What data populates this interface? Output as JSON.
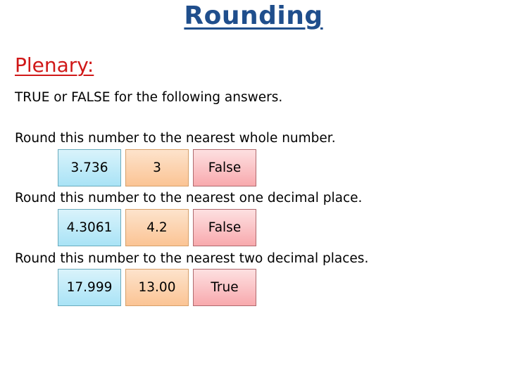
{
  "header": {
    "title": "Rounding"
  },
  "section_label": "Plenary:",
  "instruction": "TRUE or FALSE for the following answers.",
  "questions": [
    {
      "prompt": "Round this number to the nearest whole number.",
      "number": "3.736",
      "answer": "3",
      "verdict": "False"
    },
    {
      "prompt": "Round this number to the nearest one decimal place.",
      "number": "4.3061",
      "answer": "4.2",
      "verdict": "False"
    },
    {
      "prompt": "Round this number to the nearest two decimal places.",
      "number": "17.999",
      "answer": "13.00",
      "verdict": "True"
    }
  ],
  "colors": {
    "title": "#1f4e8c",
    "section_label": "#d01818",
    "number_box": "#a9e3f6",
    "answer_box": "#fbc494",
    "verdict_box": "#f8a9ad"
  }
}
